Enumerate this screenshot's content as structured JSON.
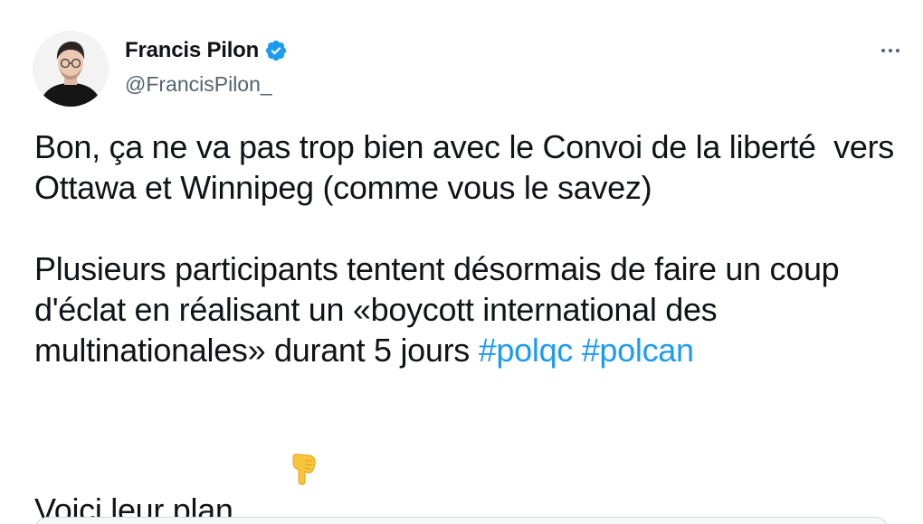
{
  "author": {
    "display_name": "Francis Pilon",
    "handle": "@FrancisPilon_",
    "verified": true,
    "verified_color": "#1d9bf0",
    "avatar_icon": "person-avatar"
  },
  "menu": {
    "icon": "more-dots-icon"
  },
  "tweet": {
    "paragraph1": "Bon, ça ne va pas trop bien avec le Convoi de la liberté  vers Ottawa et Winnipeg (comme vous le savez)",
    "paragraph2_text": "Plusieurs participants tentent désormais de faire un coup d'éclat en réalisant un «boycott international des multinationales» durant 5 jours ",
    "hashtags": [
      "#polqc",
      "#polcan"
    ],
    "paragraph3_text": "Voici leur plan",
    "paragraph3_emoji": "pointing-down-hand-icon"
  },
  "colors": {
    "text": "#0f1419",
    "secondary": "#536471",
    "link": "#1d9bf0"
  }
}
